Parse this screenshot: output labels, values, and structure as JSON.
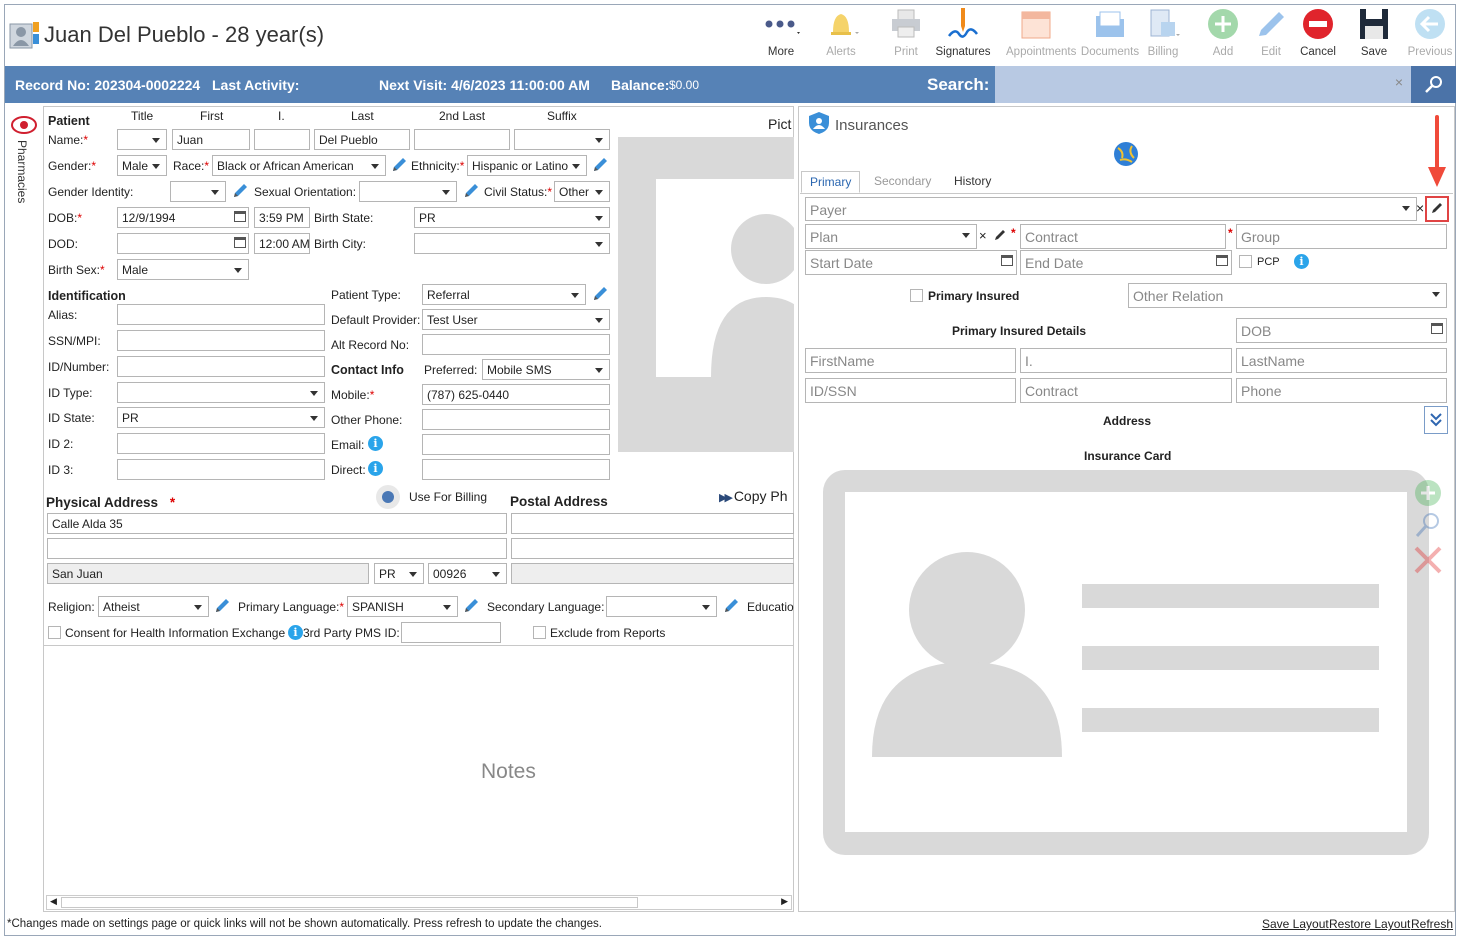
{
  "window": {
    "title": "Juan Del Pueblo - 28 year(s)"
  },
  "toolbar": [
    {
      "label": "More",
      "icon": "more-icon",
      "enabled": true
    },
    {
      "label": "Alerts",
      "icon": "bell-icon",
      "enabled": false
    },
    {
      "label": "Print",
      "icon": "printer-icon",
      "enabled": false
    },
    {
      "label": "Signatures",
      "icon": "pen-signature-icon",
      "enabled": true
    },
    {
      "label": "Appointments",
      "icon": "calendar-icon",
      "enabled": false
    },
    {
      "label": "Documents",
      "icon": "documents-icon",
      "enabled": false
    },
    {
      "label": "Billing",
      "icon": "billing-icon",
      "enabled": false
    },
    {
      "label": "Add",
      "icon": "plus-circle-icon",
      "enabled": false
    },
    {
      "label": "Edit",
      "icon": "pencil-icon",
      "enabled": false
    },
    {
      "label": "Cancel",
      "icon": "cancel-icon",
      "enabled": true
    },
    {
      "label": "Save",
      "icon": "save-icon",
      "enabled": true
    },
    {
      "label": "Previous",
      "icon": "back-arrow-icon",
      "enabled": false
    }
  ],
  "infobar": {
    "record": "Record No: 202304-0002224",
    "last_activity": "Last Activity:",
    "next_visit": "Next Visit: 4/6/2023 11:00:00 AM",
    "balance_label": "Balance:",
    "balance_value": "$0.00",
    "search_label": "Search:"
  },
  "side": {
    "pharmacies": "Pharmacies"
  },
  "patient": {
    "section": "Patient",
    "col_title": "Title",
    "col_first": "First",
    "col_i": "I.",
    "col_last": "Last",
    "col_2nd": "2nd Last",
    "col_suffix": "Suffix",
    "name_label": "Name:",
    "first": "Juan",
    "last": "Del Pueblo",
    "gender_label": "Gender:",
    "gender": "Male",
    "race_label": "Race:",
    "race": "Black or African American",
    "ethnicity_label": "Ethnicity:",
    "ethnicity": "Hispanic or Latino",
    "gender_identity_label": "Gender Identity:",
    "sexual_orientation_label": "Sexual Orientation:",
    "civil_status_label": "Civil Status:",
    "civil_status": "Other",
    "dob_label": "DOB:",
    "dob": "12/9/1994",
    "dob_time": "3:59 PM",
    "birth_state_label": "Birth State:",
    "birth_state": "PR",
    "dod_label": "DOD:",
    "dod_time": "12:00 AM",
    "birth_city_label": "Birth City:",
    "birth_sex_label": "Birth Sex:",
    "birth_sex": "Male",
    "picture_label": "Pict"
  },
  "identification": {
    "section": "Identification",
    "alias": "Alias:",
    "ssn": "SSN/MPI:",
    "idnumber": "ID/Number:",
    "idtype": "ID Type:",
    "idstate": "ID State:",
    "idstate_value": "PR",
    "id2": "ID 2:",
    "id3": "ID 3:"
  },
  "patient_type": {
    "label": "Patient Type:",
    "value": "Referral",
    "provider_label": "Default Provider:",
    "provider": "Test User",
    "alt_label": "Alt Record No:"
  },
  "contact": {
    "section": "Contact Info",
    "preferred_label": "Preferred:",
    "preferred": "Mobile SMS",
    "mobile_label": "Mobile:",
    "mobile": "(787) 625-0440",
    "other_label": "Other Phone:",
    "email_label": "Email:",
    "direct_label": "Direct:"
  },
  "address": {
    "physical": "Physical Address",
    "use_billing": "Use For Billing",
    "postal": "Postal Address",
    "copy": "Copy Ph",
    "line1": "Calle Alda 35",
    "city": "San Juan",
    "state": "PR",
    "zip": "00926"
  },
  "misc": {
    "religion_label": "Religion:",
    "religion": "Atheist",
    "primary_lang_label": "Primary Language:",
    "primary_lang": "SPANISH",
    "secondary_lang_label": "Secondary Language:",
    "education_label": "Educatio",
    "consent": "Consent for Health Information Exchange",
    "third_party": "3rd Party PMS ID:",
    "exclude": "Exclude from Reports",
    "notes": "Notes"
  },
  "insurance": {
    "title": "Insurances",
    "tabs": [
      "Primary",
      "Secondary",
      "History"
    ],
    "payer": "Payer",
    "plan": "Plan",
    "contract": "Contract",
    "group": "Group",
    "start": "Start Date",
    "end": "End Date",
    "pcp": "PCP",
    "primary_insured": "Primary Insured",
    "other_relation": "Other Relation",
    "details": "Primary Insured Details",
    "dob": "DOB",
    "firstname": "FirstName",
    "i": "I.",
    "lastname": "LastName",
    "idssn": "ID/SSN",
    "contract2": "Contract",
    "phone": "Phone",
    "address": "Address",
    "card": "Insurance Card"
  },
  "footer": {
    "note": "*Changes made on settings page or quick links will not be shown automatically. Press refresh to update the changes.",
    "save_layout": "Save Layout",
    "restore_layout": "Restore Layout",
    "refresh": "Refresh"
  }
}
